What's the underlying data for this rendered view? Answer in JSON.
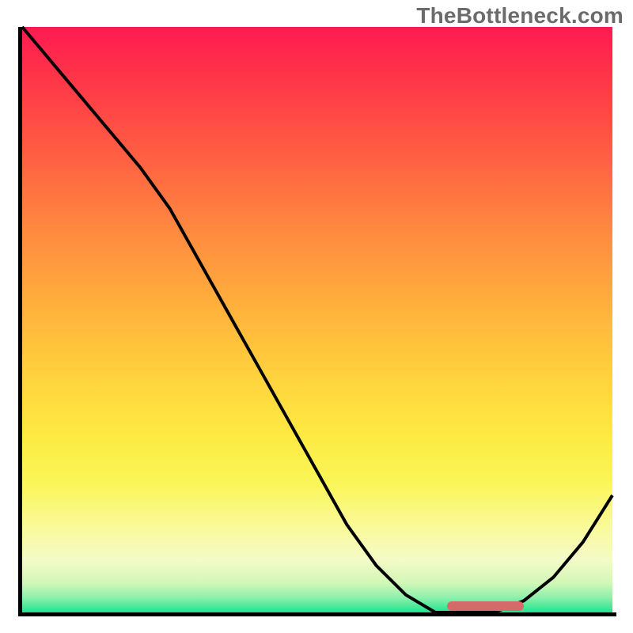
{
  "watermark": "TheBottleneck.com",
  "colors": {
    "axis": "#000000",
    "curve": "#000000",
    "marker": "#d46a6a",
    "gradient_top": "#ff1a51",
    "gradient_bottom": "#20e38e"
  },
  "chart_data": {
    "type": "line",
    "title": "",
    "xlabel": "",
    "ylabel": "",
    "xlim": [
      0,
      100
    ],
    "ylim": [
      0,
      100
    ],
    "x": [
      0,
      5,
      10,
      15,
      20,
      25,
      30,
      35,
      40,
      45,
      50,
      55,
      60,
      65,
      70,
      75,
      80,
      85,
      90,
      95,
      100
    ],
    "values": [
      100,
      94,
      88,
      82,
      76,
      69,
      60,
      51,
      42,
      33,
      24,
      15,
      8,
      3,
      0,
      0,
      0,
      2,
      6,
      12,
      20
    ],
    "optimal_range_x": [
      72,
      85
    ],
    "annotations": []
  }
}
